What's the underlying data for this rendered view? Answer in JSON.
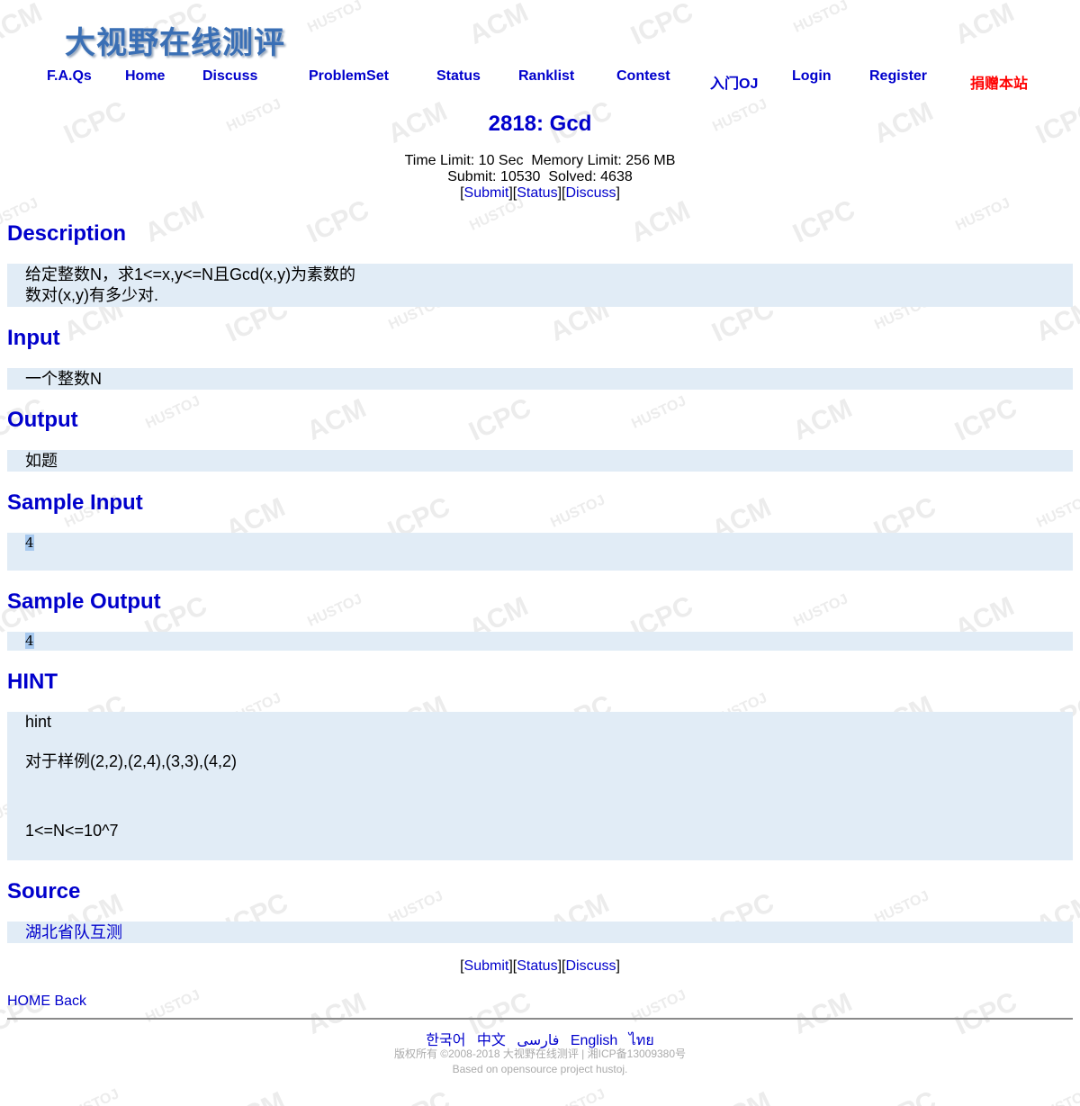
{
  "logo": {
    "text": "大视野在线测评"
  },
  "nav": {
    "faqs": "F.A.Qs",
    "home": "Home",
    "discuss": "Discuss",
    "problemset": "ProblemSet",
    "status": "Status",
    "ranklist": "Ranklist",
    "contest": "Contest",
    "intro": "入门OJ",
    "login": "Login",
    "register": "Register",
    "donate": "捐赠本站"
  },
  "problem": {
    "title": "2818: Gcd",
    "time_limit_label": "Time Limit:",
    "time_limit": "10 Sec",
    "memory_limit_label": "Memory Limit:",
    "memory_limit": "256 MB",
    "submit_label": "Submit:",
    "submit_count": "10530",
    "solved_label": "Solved:",
    "solved_count": "4638"
  },
  "actions": {
    "submit": "Submit",
    "status": "Status",
    "discuss": "Discuss"
  },
  "sections": {
    "description": {
      "heading": "Description",
      "line1": "给定整数N，求1<=x,y<=N且Gcd(x,y)为素数的",
      "line2": "数对(x,y)有多少对."
    },
    "input": {
      "heading": "Input",
      "text": "一个整数N"
    },
    "output": {
      "heading": "Output",
      "text": "如题"
    },
    "sample_input": {
      "heading": "Sample Input",
      "text": "4"
    },
    "sample_output": {
      "heading": "Sample Output",
      "text": "4"
    },
    "hint": {
      "heading": "HINT",
      "line1": "hint",
      "line2": "对于样例(2,2),(2,4),(3,3),(4,2)",
      "line3": "1<=N<=10^7"
    },
    "source": {
      "heading": "Source",
      "text": "湖北省队互测"
    }
  },
  "footer": {
    "home": "HOME",
    "back": "Back",
    "languages": [
      "한국어",
      "中文",
      "فارسی",
      "English",
      "ไทย"
    ],
    "copyright": "版权所有 ©2008-2018 大视野在线测评 | 湘ICP备13009380号",
    "based_on": "Based on opensource project hustoj."
  },
  "watermark": [
    "ACM",
    "ICPC",
    "HUSTOJ"
  ],
  "colors": {
    "link": "#0000cc",
    "donate": "#ff0000",
    "box_bg": "#e1ecf6",
    "watermark": "#ececec",
    "logo": "#3a6fb5"
  }
}
